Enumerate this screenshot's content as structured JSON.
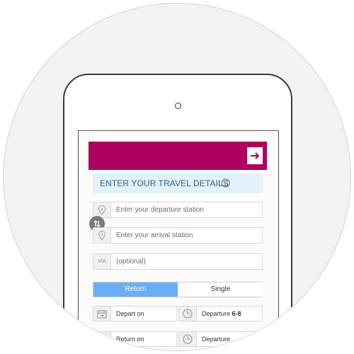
{
  "header": {
    "title": "ENTER YOUR TRAVEL DETAILS"
  },
  "stations": {
    "departure_placeholder": "Enter your departure station",
    "arrival_placeholder": "Enter your arrival station",
    "via_label": "VIA",
    "via_placeholder": "(optional)"
  },
  "trip_type": {
    "return_label": "Return",
    "single_label": "Single",
    "selected": "Return"
  },
  "depart": {
    "date_label": "Depart on",
    "time_label": "Departure",
    "time_value": "6-8"
  },
  "return_row": {
    "date_label": "Return on",
    "time_label": "Departure"
  },
  "colors": {
    "brand": "#b0005f",
    "accent": "#6aaef5",
    "header_bg": "#e3f1fb"
  },
  "icons": {
    "next": "arrow-right-icon",
    "info": "info-icon",
    "location": "location-pin-icon",
    "swap": "swap-icon",
    "calendar": "calendar-icon",
    "clock": "clock-icon"
  }
}
